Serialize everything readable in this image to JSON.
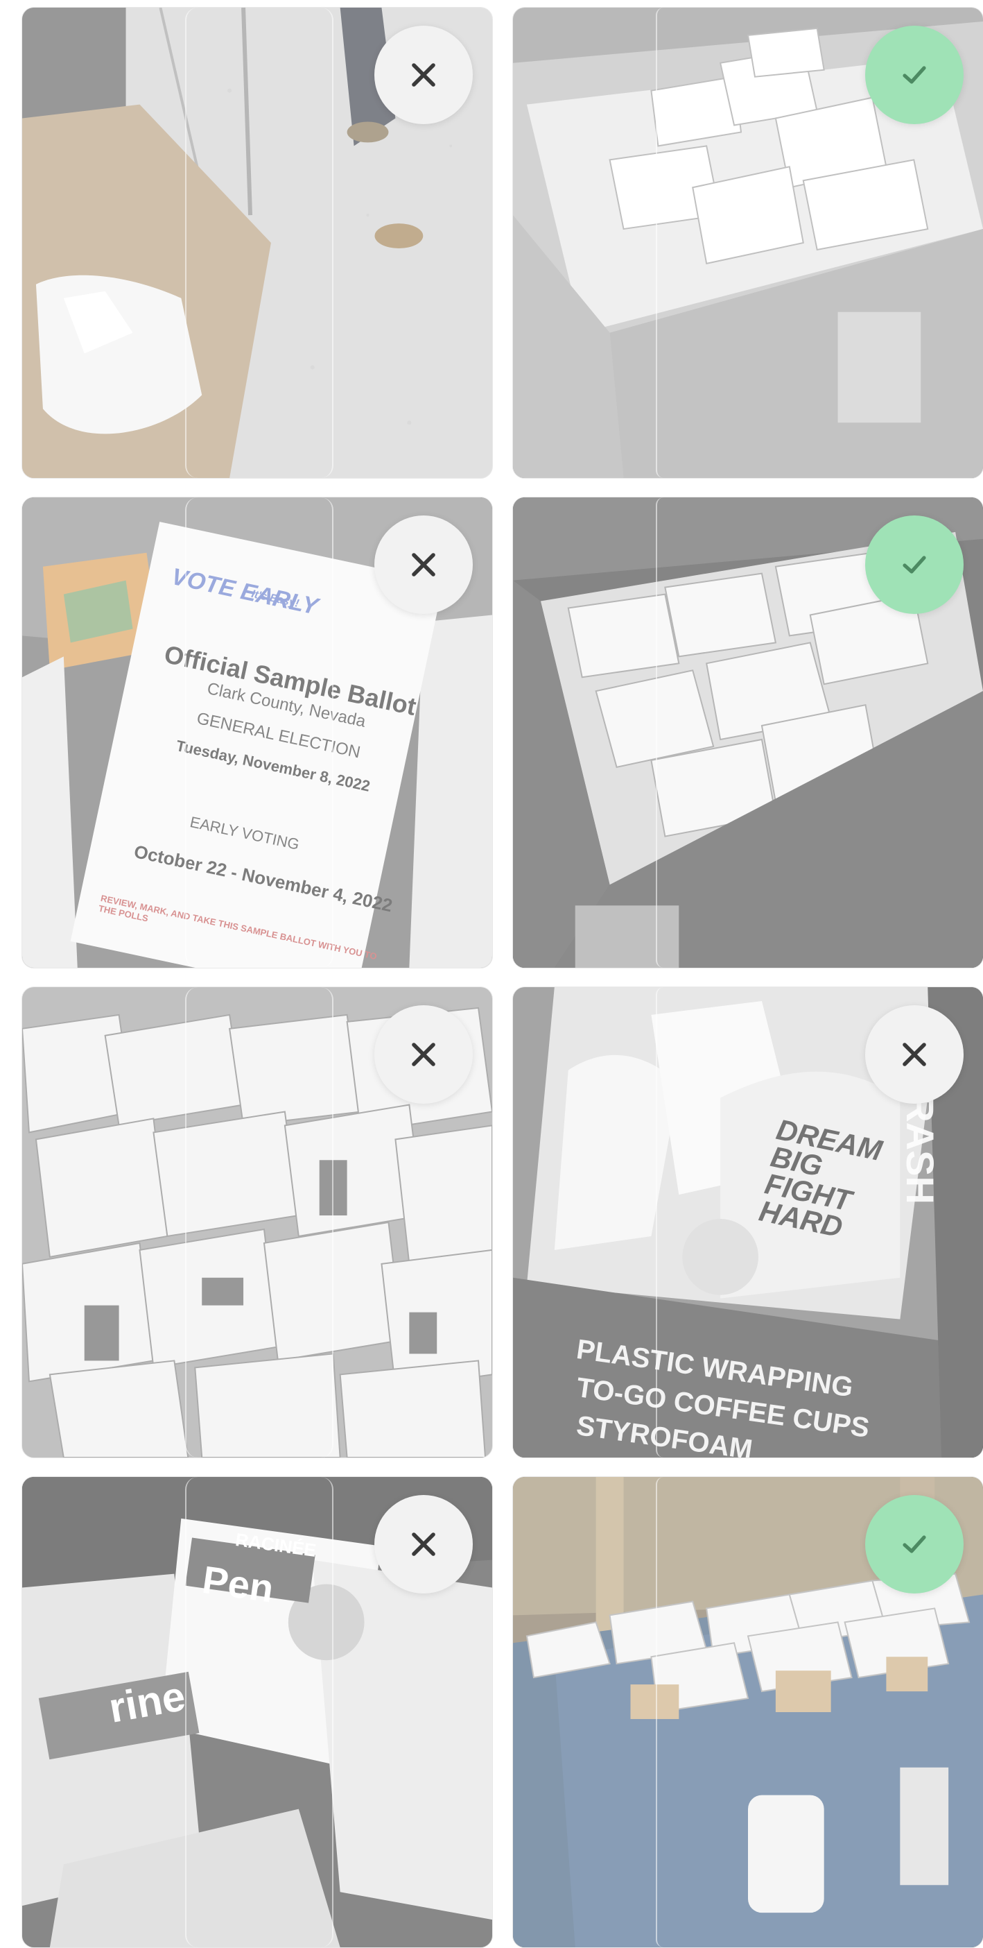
{
  "tiles": [
    {
      "id": "tile-1",
      "status": "rejected",
      "badge_icon": "close-icon"
    },
    {
      "id": "tile-2",
      "status": "accepted",
      "badge_icon": "check-icon"
    },
    {
      "id": "tile-3",
      "status": "rejected",
      "badge_icon": "close-icon",
      "image_text": {
        "heading": "VOTE EARLY",
        "subheading": "It's Easy!",
        "title": "Official Sample Ballot",
        "county": "Clark County, Nevada",
        "election": "GENERAL ELECTION",
        "date": "Tuesday, November 8, 2022",
        "early": "EARLY VOTING",
        "early_dates": "October 22 - November 4, 2022",
        "notice": "REVIEW, MARK, AND TAKE THIS SAMPLE BALLOT WITH YOU TO THE POLLS"
      }
    },
    {
      "id": "tile-4",
      "status": "accepted",
      "badge_icon": "check-icon"
    },
    {
      "id": "tile-5",
      "status": "rejected",
      "badge_icon": "close-icon"
    },
    {
      "id": "tile-6",
      "status": "rejected",
      "badge_icon": "close-icon",
      "image_text": {
        "flyer": "DREAM BIG FIGHT HARD",
        "line1": "PLASTIC WRAPPING",
        "line2": "TO-GO COFFEE CUPS",
        "line3": "STYROFOAM",
        "side": "TRASH"
      }
    },
    {
      "id": "tile-7",
      "status": "rejected",
      "badge_icon": "close-icon",
      "image_text": {
        "name": "Pen",
        "header": "RACINÉE",
        "left": "rine"
      }
    },
    {
      "id": "tile-8",
      "status": "accepted",
      "badge_icon": "check-icon"
    }
  ],
  "colors": {
    "accept_badge": "#9fe2b6",
    "reject_badge": "#f2f2f2",
    "icon_dark": "#3a3a3a",
    "icon_accept": "#4c8a62"
  }
}
